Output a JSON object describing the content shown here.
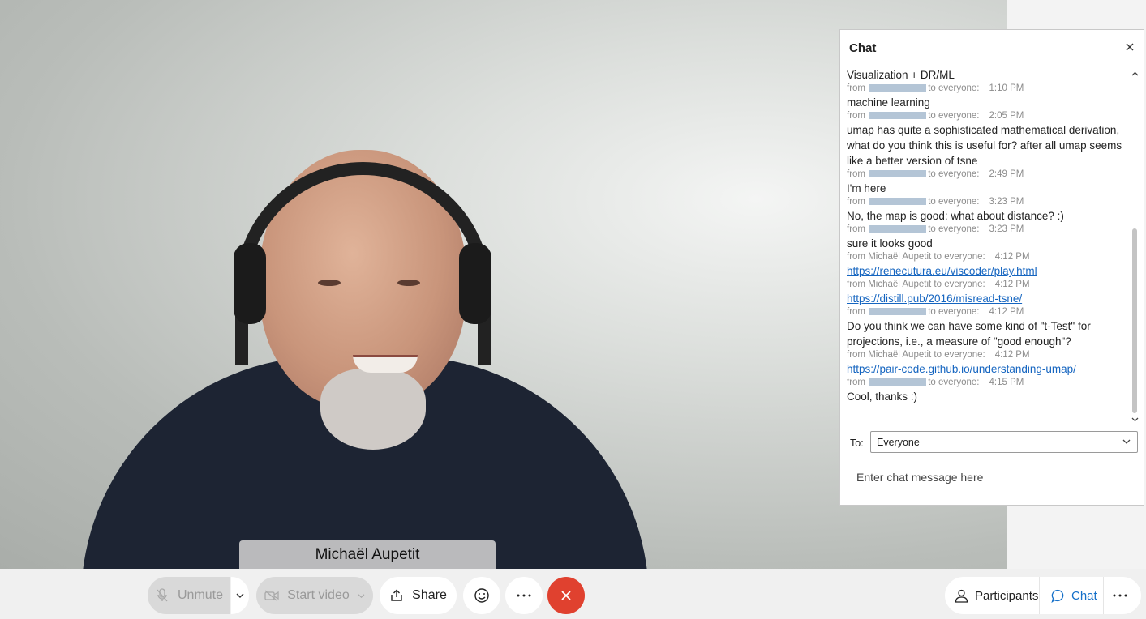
{
  "video": {
    "participant_name": "Michaël Aupetit"
  },
  "chat": {
    "title": "Chat",
    "messages": [
      {
        "text": "Visualization + DR/ML",
        "from": "",
        "to": "to everyone:",
        "time": "1:10 PM",
        "redacted": true,
        "is_link": false
      },
      {
        "text": "machine learning",
        "from": "",
        "to": "to everyone:",
        "time": "2:05 PM",
        "redacted": true,
        "is_link": false
      },
      {
        "text": "umap has quite a sophisticated mathematical derivation, what do you think this is useful for? after all umap seems like a better version of tsne",
        "from": "",
        "to": "to everyone:",
        "time": "2:49 PM",
        "redacted": true,
        "is_link": false
      },
      {
        "text": "I'm here",
        "from": "",
        "to": "to everyone:",
        "time": "3:23 PM",
        "redacted": true,
        "is_link": false
      },
      {
        "text": "No, the map is good: what about distance? :)",
        "from": "",
        "to": "to everyone:",
        "time": "3:23 PM",
        "redacted": true,
        "is_link": false
      },
      {
        "text": "sure it looks good",
        "from": "Michaël Aupetit",
        "to": "to everyone:",
        "time": "4:12 PM",
        "redacted": false,
        "is_link": false
      },
      {
        "text": "https://renecutura.eu/viscoder/play.html",
        "from": "Michaël Aupetit",
        "to": "to everyone:",
        "time": "4:12 PM",
        "redacted": false,
        "is_link": true
      },
      {
        "text": "https://distill.pub/2016/misread-tsne/",
        "from": "",
        "to": "to everyone:",
        "time": "4:12 PM",
        "redacted": true,
        "is_link": true
      },
      {
        "text": "Do you think we can have some kind of \"t-Test\" for projections, i.e., a measure of \"good enough\"?",
        "from": "Michaël Aupetit",
        "to": "to everyone:",
        "time": "4:12 PM",
        "redacted": false,
        "is_link": false
      },
      {
        "text": "https://pair-code.github.io/understanding-umap/",
        "from": "",
        "to": "to everyone:",
        "time": "4:15 PM",
        "redacted": true,
        "is_link": true
      },
      {
        "text": "Cool, thanks :)",
        "from": null,
        "to": null,
        "time": null,
        "redacted": false,
        "is_link": false
      }
    ],
    "from_prefix": "from",
    "to_label": "To:",
    "to_value": "Everyone",
    "input_placeholder": "Enter chat message here"
  },
  "toolbar": {
    "unmute_label": "Unmute",
    "start_video_label": "Start video",
    "share_label": "Share",
    "participants_label": "Participants",
    "chat_label": "Chat"
  },
  "colors": {
    "accent": "#1570c9",
    "end_call": "#e0412f",
    "link": "#1565c0"
  },
  "icons": [
    "microphone-muted-icon",
    "camera-off-icon",
    "share-icon",
    "emoji-icon",
    "more-icon",
    "end-call-icon",
    "participants-icon",
    "chat-bubble-icon",
    "close-icon"
  ]
}
